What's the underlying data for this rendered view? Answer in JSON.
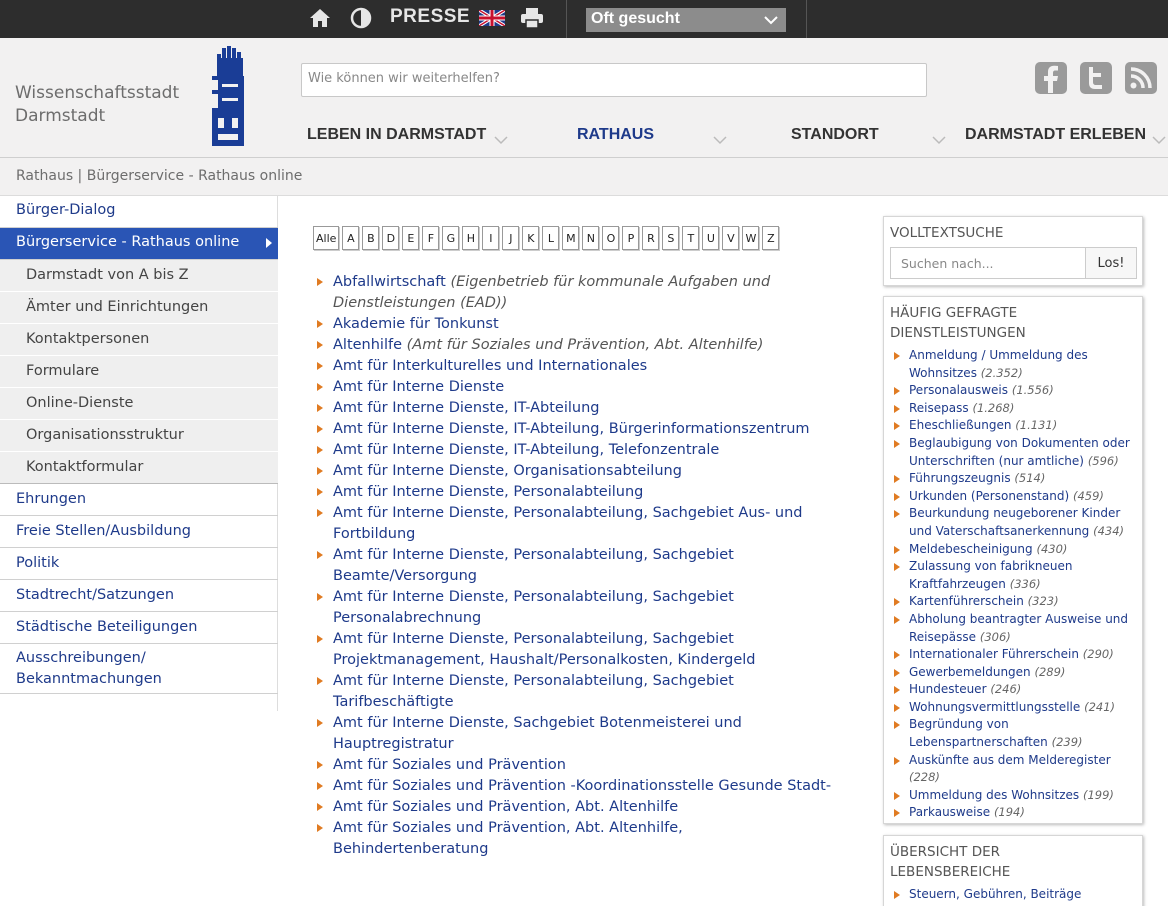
{
  "topbar": {
    "presse": "PRESSE",
    "oft_gesucht": "Oft gesucht",
    "icons": [
      "home-icon",
      "contrast-icon",
      "uk-flag-icon",
      "print-icon",
      "chevron-down-icon"
    ]
  },
  "header": {
    "logo_line1": "Wissenschaftsstadt",
    "logo_line2": "Darmstadt",
    "search_placeholder": "Wie können wir weiterhelfen?",
    "nav": [
      {
        "label": "LEBEN IN DARMSTADT"
      },
      {
        "label": "RATHAUS"
      },
      {
        "label": "STANDORT"
      },
      {
        "label": "DARMSTADT ERLEBEN"
      }
    ],
    "social_icons": [
      "facebook-icon",
      "twitter-icon",
      "rss-icon"
    ]
  },
  "breadcrumb": "Rathaus | Bürgerservice - Rathaus online",
  "sidebar": {
    "top": [
      "Bürger-Dialog",
      "Bürgerservice - Rathaus online"
    ],
    "sub": [
      "Darmstadt von A bis Z",
      "Ämter und Einrichtungen",
      "Kontaktpersonen",
      "Formulare",
      "Online-Dienste",
      "Organisationsstruktur",
      "Kontaktformular"
    ],
    "bottom": [
      "Ehrungen",
      "Freie Stellen/Ausbildung",
      "Politik",
      "Stadtrecht/Satzungen",
      "Städtische Beteiligungen",
      "Ausschreibungen/",
      "Bekanntmachungen"
    ]
  },
  "letters": [
    "Alle",
    "A",
    "B",
    "D",
    "E",
    "F",
    "G",
    "H",
    "I",
    "J",
    "K",
    "L",
    "M",
    "N",
    "O",
    "P",
    "R",
    "S",
    "T",
    "U",
    "V",
    "W",
    "Z"
  ],
  "results": [
    {
      "l1": "Abfallwirtschaft",
      "n1": " (Eigenbetrieb für kommunale Aufgaben und",
      "l2": "",
      "n2": "Dienstleistungen (EAD))"
    },
    {
      "l1": "Akademie für Tonkunst"
    },
    {
      "l1": "Altenhilfe",
      "n1": " (Amt für Soziales und Prävention, Abt. Altenhilfe)"
    },
    {
      "l1": "Amt für Interkulturelles und Internationales"
    },
    {
      "l1": "Amt für Interne Dienste"
    },
    {
      "l1": "Amt für Interne Dienste, IT-Abteilung"
    },
    {
      "l1": "Amt für Interne Dienste, IT-Abteilung, Bürgerinformationszentrum"
    },
    {
      "l1": "Amt für Interne Dienste, IT-Abteilung, Telefonzentrale"
    },
    {
      "l1": "Amt für Interne Dienste, Organisationsabteilung"
    },
    {
      "l1": "Amt für Interne Dienste, Personalabteilung"
    },
    {
      "l1": "Amt für Interne Dienste, Personalabteilung, Sachgebiet Aus- und",
      "l2": "Fortbildung"
    },
    {
      "l1": "Amt für Interne Dienste, Personalabteilung, Sachgebiet",
      "l2": "Beamte/Versorgung"
    },
    {
      "l1": "Amt für Interne Dienste, Personalabteilung, Sachgebiet",
      "l2": "Personalabrechnung"
    },
    {
      "l1": "Amt für Interne Dienste, Personalabteilung, Sachgebiet",
      "l2": "Projektmanagement, Haushalt/Personalkosten, Kindergeld"
    },
    {
      "l1": "Amt für Interne Dienste, Personalabteilung, Sachgebiet",
      "l2": "Tarifbeschäftigte"
    },
    {
      "l1": "Amt für Interne Dienste, Sachgebiet Botenmeisterei und",
      "l2": "Hauptregistratur"
    },
    {
      "l1": "Amt für Soziales und Prävention"
    },
    {
      "l1": "Amt für Soziales und Prävention -Koordinationsstelle Gesunde Stadt-"
    },
    {
      "l1": "Amt für Soziales und Prävention, Abt. Altenhilfe"
    },
    {
      "l1": "Amt für Soziales und Prävention, Abt. Altenhilfe,",
      "l2": "Behindertenberatung"
    }
  ],
  "volltext": {
    "title": "VOLLTEXTSUCHE",
    "placeholder": "Suchen nach...",
    "button": "Los!"
  },
  "faq": {
    "title1": "HÄUFIG GEFRAGTE",
    "title2": "DIENSTLEISTUNGEN",
    "items": [
      {
        "l1": "Anmeldung / Ummeldung des",
        "l2": "Wohnsitzes",
        "c": "(2.352)"
      },
      {
        "l1": "Personalausweis",
        "c": "(1.556)"
      },
      {
        "l1": "Reisepass",
        "c": "(1.268)"
      },
      {
        "l1": "Eheschließungen",
        "c": "(1.131)"
      },
      {
        "l1": "Beglaubigung von Dokumenten oder",
        "l2": "Unterschriften (nur amtliche)",
        "c": "(596)"
      },
      {
        "l1": "Führungszeugnis",
        "c": "(514)"
      },
      {
        "l1": "Urkunden (Personenstand)",
        "c": "(459)"
      },
      {
        "l1": "Beurkundung neugeborener Kinder",
        "l2": "und Vaterschaftsanerkennung",
        "c": "(434)"
      },
      {
        "l1": "Meldebescheinigung",
        "c": "(430)"
      },
      {
        "l1": "Zulassung von fabrikneuen",
        "l2": "Kraftfahrzeugen",
        "c": "(336)"
      },
      {
        "l1": "Kartenführerschein",
        "c": "(323)"
      },
      {
        "l1": "Abholung beantragter Ausweise und",
        "l2": "Reisepässe",
        "c": "(306)"
      },
      {
        "l1": "Internationaler Führerschein",
        "c": "(290)"
      },
      {
        "l1": "Gewerbemeldungen",
        "c": "(289)"
      },
      {
        "l1": "Hundesteuer",
        "c": "(246)"
      },
      {
        "l1": "Wohnungsvermittlungsstelle",
        "c": "(241)"
      },
      {
        "l1": "Begründung von",
        "l2": "Lebenspartnerschaften",
        "c": "(239)"
      },
      {
        "l1": "Auskünfte aus dem Melderegister",
        "c": "(228)"
      },
      {
        "l1": "Ummeldung des Wohnsitzes",
        "c": "(199)"
      },
      {
        "l1": "Parkausweise",
        "c": "(194)"
      }
    ]
  },
  "lebensbereiche": {
    "title1": "ÜBERSICHT DER",
    "title2": "LEBENSBEREICHE",
    "items": [
      "Steuern, Gebühren, Beiträge"
    ]
  }
}
